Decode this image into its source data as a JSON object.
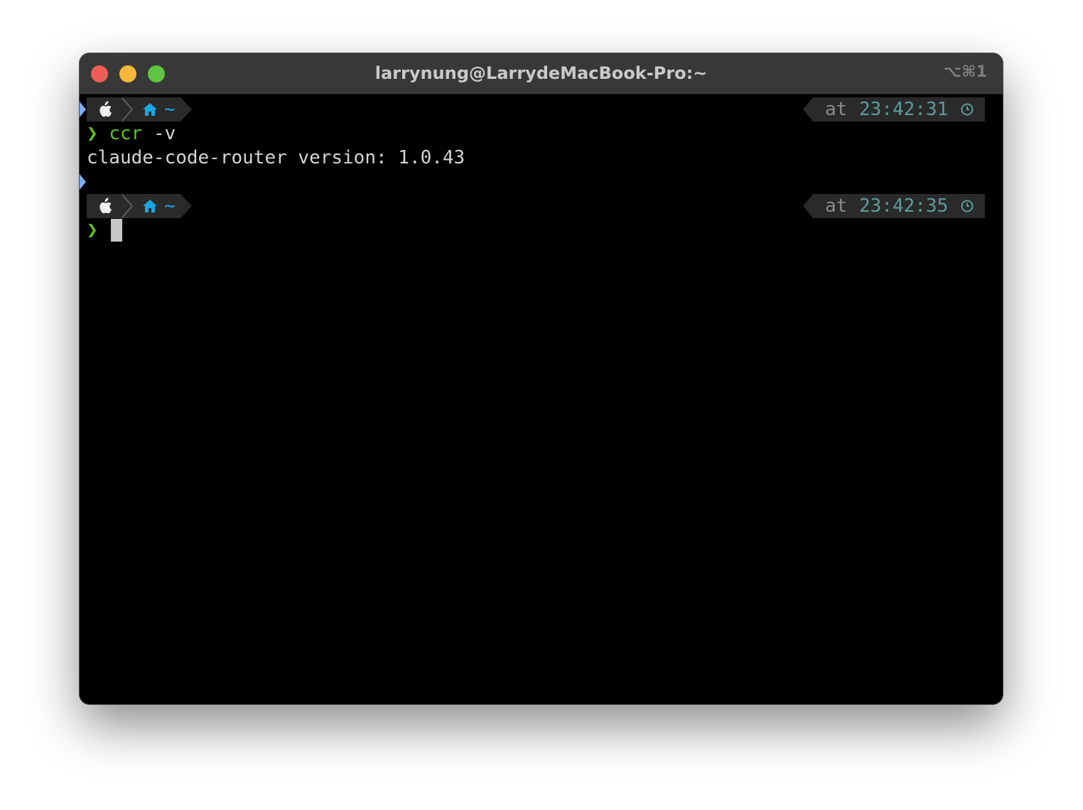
{
  "window": {
    "title": "larrynung@LarrydeMacBook-Pro:~",
    "shortcut": "⌥⌘1"
  },
  "prompts": [
    {
      "dir": "~",
      "at_label": "at",
      "time": "23:42:31"
    },
    {
      "dir": "~",
      "at_label": "at",
      "time": "23:42:35"
    }
  ],
  "lines": {
    "prompt_char": "❯",
    "command": "ccr",
    "command_arg": "-v",
    "output": "claude-code-router version: 1.0.43"
  },
  "colors": {
    "prompt_green": "#5ec61f",
    "home_blue": "#1aa6e2",
    "time_teal": "#5d9b99",
    "segment_bg": "#2a2a2a"
  },
  "icons": [
    "apple-icon",
    "chevron-right-icon",
    "home-icon",
    "clock-icon"
  ]
}
